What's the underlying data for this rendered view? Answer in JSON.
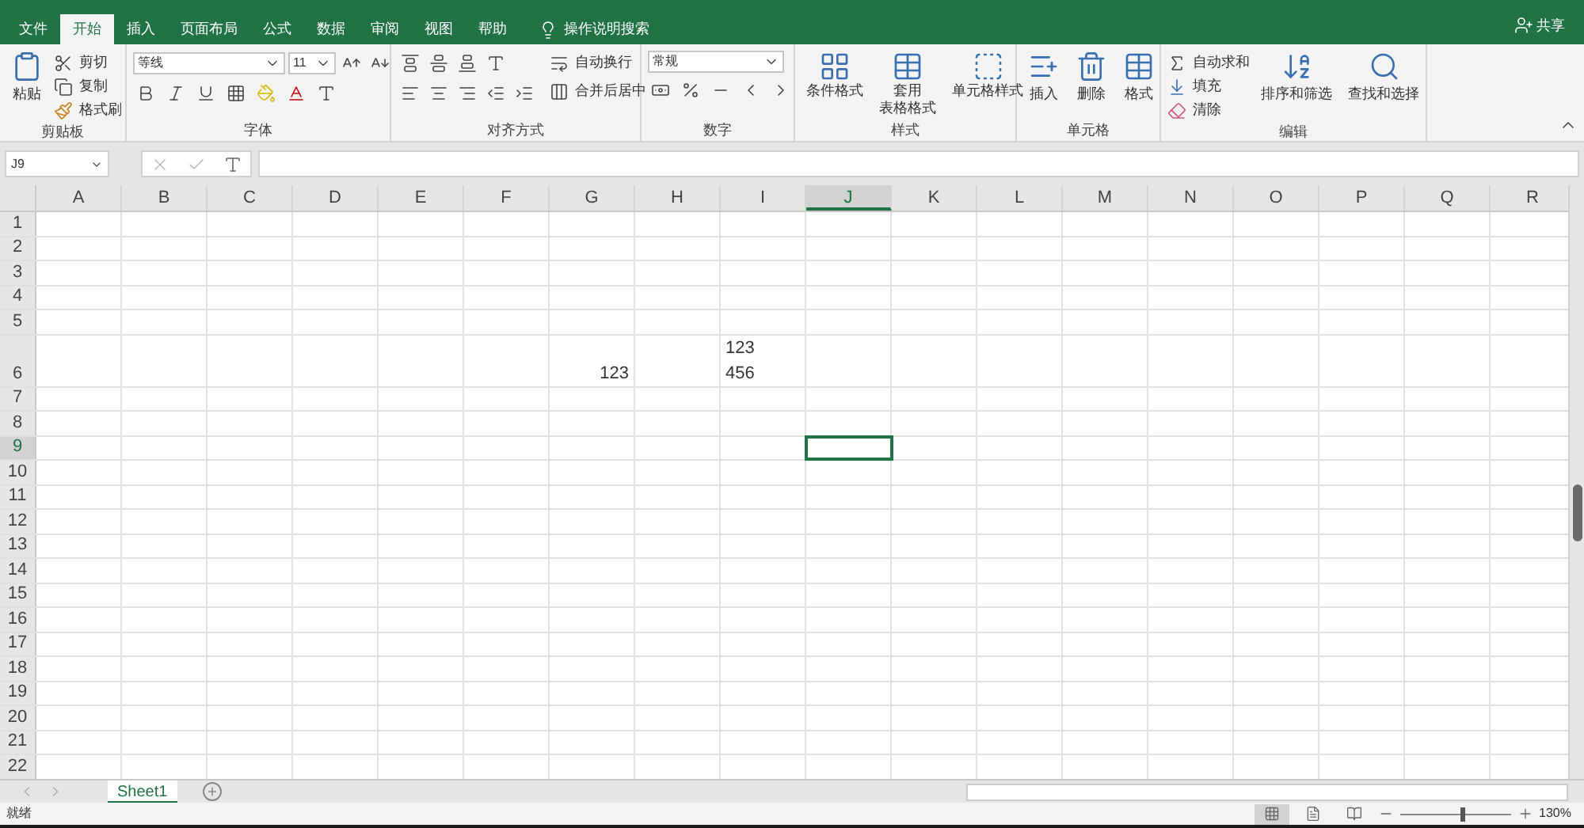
{
  "menu_tabs": [
    {
      "label": "文件",
      "selected": false
    },
    {
      "label": "开始",
      "selected": true
    },
    {
      "label": "插入",
      "selected": false
    },
    {
      "label": "页面布局",
      "selected": false
    },
    {
      "label": "公式",
      "selected": false
    },
    {
      "label": "数据",
      "selected": false
    },
    {
      "label": "审阅",
      "selected": false
    },
    {
      "label": "视图",
      "selected": false
    },
    {
      "label": "帮助",
      "selected": false
    }
  ],
  "tell_me": "操作说明搜索",
  "share": "共享",
  "ribbon": {
    "clipboard": {
      "label": "剪贴板",
      "paste": "粘贴",
      "cut": "剪切",
      "copy": "复制",
      "format_painter": "格式刷"
    },
    "font": {
      "label": "字体",
      "font_name": "等线",
      "font_size": "11"
    },
    "alignment": {
      "label": "对齐方式",
      "wrap_text": "自动换行",
      "merge_center": "合并后居中"
    },
    "number": {
      "label": "数字",
      "format": "常规"
    },
    "styles": {
      "label": "样式",
      "buttons": [
        {
          "lines": [
            "条件格式"
          ]
        },
        {
          "lines": [
            "套用",
            "表格格式"
          ]
        },
        {
          "lines": [
            "单元格样式"
          ]
        }
      ]
    },
    "cells": {
      "label": "单元格",
      "buttons": [
        "插入",
        "删除",
        "格式"
      ]
    },
    "editing": {
      "label": "编辑",
      "autosum": "自动求和",
      "fill": "填充",
      "clear": "清除",
      "sort_filter": "排序和筛选",
      "find_select": "查找和选择"
    }
  },
  "formula_bar": {
    "name_box": "J9"
  },
  "sheet": {
    "columns": [
      {
        "label": "A",
        "selected": false
      },
      {
        "label": "B",
        "selected": false
      },
      {
        "label": "C",
        "selected": false
      },
      {
        "label": "D",
        "selected": false
      },
      {
        "label": "E",
        "selected": false
      },
      {
        "label": "F",
        "selected": false
      },
      {
        "label": "G",
        "selected": false
      },
      {
        "label": "H",
        "selected": false
      },
      {
        "label": "I",
        "selected": false
      },
      {
        "label": "J",
        "selected": true
      },
      {
        "label": "K",
        "selected": false
      },
      {
        "label": "L",
        "selected": false
      },
      {
        "label": "M",
        "selected": false
      },
      {
        "label": "N",
        "selected": false
      },
      {
        "label": "O",
        "selected": false
      },
      {
        "label": "P",
        "selected": false
      },
      {
        "label": "Q",
        "selected": false
      },
      {
        "label": "R",
        "selected": false
      }
    ],
    "rows": [
      {
        "label": "1",
        "selected": false
      },
      {
        "label": "2",
        "selected": false
      },
      {
        "label": "3",
        "selected": false
      },
      {
        "label": "4",
        "selected": false
      },
      {
        "label": "5",
        "selected": false
      },
      {
        "label": "6",
        "selected": false,
        "cells": {
          "G": "123",
          "I": "123\n456"
        }
      },
      {
        "label": "7",
        "selected": false
      },
      {
        "label": "8",
        "selected": false
      },
      {
        "label": "9",
        "selected": true
      },
      {
        "label": "10",
        "selected": false
      },
      {
        "label": "11",
        "selected": false
      },
      {
        "label": "12",
        "selected": false
      },
      {
        "label": "13",
        "selected": false
      },
      {
        "label": "14",
        "selected": false
      },
      {
        "label": "15",
        "selected": false
      },
      {
        "label": "16",
        "selected": false
      },
      {
        "label": "17",
        "selected": false
      },
      {
        "label": "18",
        "selected": false
      },
      {
        "label": "19",
        "selected": false
      },
      {
        "label": "20",
        "selected": false
      },
      {
        "label": "21",
        "selected": false
      },
      {
        "label": "22",
        "selected": false
      }
    ]
  },
  "sheet_tabs": [
    {
      "label": "Sheet1",
      "selected": true
    }
  ],
  "status_bar": {
    "status": "就绪",
    "views": [
      {
        "kind": "normal",
        "selected": true
      },
      {
        "kind": "layout",
        "selected": false
      },
      {
        "kind": "break",
        "selected": false
      }
    ],
    "zoom": {
      "level": 0.57
    },
    "zoom_reading": "130%"
  }
}
